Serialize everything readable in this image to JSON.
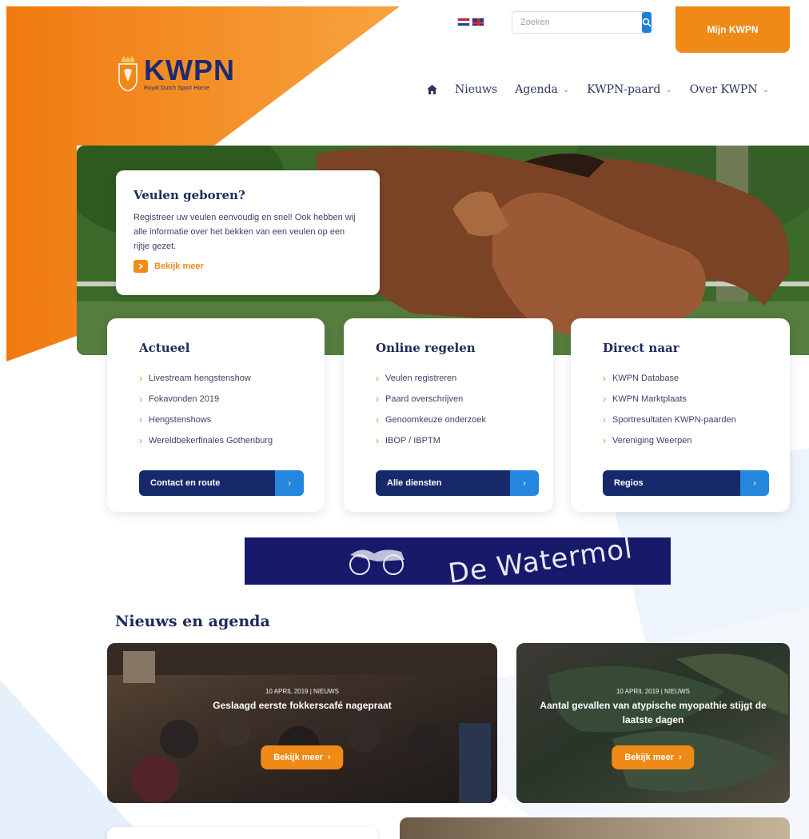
{
  "header": {
    "languages": [
      "nl",
      "en"
    ],
    "search_placeholder": "Zoeken",
    "account_button": "Mijn KWPN"
  },
  "logo": {
    "word": "KWPN",
    "tagline": "Royal Dutch Sport Horse"
  },
  "nav": {
    "items": [
      {
        "label": "",
        "icon": "home-icon"
      },
      {
        "label": "Nieuws"
      },
      {
        "label": "Agenda",
        "dropdown": true
      },
      {
        "label": "KWPN-paard",
        "dropdown": true
      },
      {
        "label": "Over KWPN",
        "dropdown": true
      }
    ]
  },
  "hero": {
    "title": "Veulen geboren?",
    "text": "Registreer uw veulen eenvoudig en snel! Ook hebben wij alle informatie over het bekken van een veulen op een rijtje gezet.",
    "link": "Bekijk meer"
  },
  "cards": [
    {
      "title": "Actueel",
      "items": [
        "Livestream hengstenshow",
        "Fokavonden 2019",
        "Hengstenshows",
        "Wereldbekerfinales Gothenburg"
      ],
      "button": "Contact en route"
    },
    {
      "title": "Online regelen",
      "items": [
        "Veulen registreren",
        "Paard overschrijven",
        "Genoomkeuze onderzoek",
        "IBOP / IBPTM"
      ],
      "button": "Alle diensten"
    },
    {
      "title": "Direct naar",
      "items": [
        "KWPN Database",
        "KWPN Marktplaats",
        "Sportresultaten KWPN-paarden",
        "Vereniging Weerpen"
      ],
      "button": "Regios"
    }
  ],
  "banner": {
    "text": "De Watermol"
  },
  "news": {
    "heading": "Nieuws en agenda",
    "items": [
      {
        "meta": "10 APRIL 2019 | NIEUWS",
        "title": "Geslaagd eerste fokkerscafé nagepraat",
        "button": "Bekijk meer"
      },
      {
        "meta": "10 APRIL 2019 | NIEUWS",
        "title": "Aantal gevallen van atypische myopathie stijgt de laatste dagen",
        "button": "Bekijk meer"
      }
    ]
  },
  "colors": {
    "accent": "#f08a17",
    "navy": "#16296a",
    "blue": "#2486dc"
  }
}
